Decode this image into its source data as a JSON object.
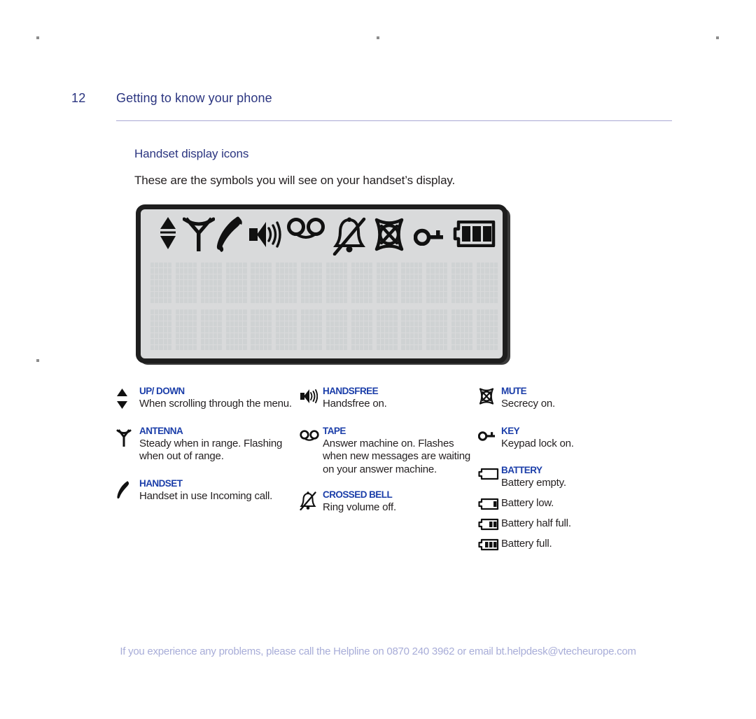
{
  "page": {
    "number": "12",
    "header_title": "Getting to know your phone",
    "section_title": "Handset display icons",
    "section_intro": "These are the symbols you will see on your handset’s display.",
    "footer": "If you experience any problems, please call the Helpline on 0870 240 3962 or email bt.helpdesk@vtecheurope.com"
  },
  "colors": {
    "heading_navy": "#2b3580",
    "term_blue": "#1b3ea9",
    "body_text": "#231f20",
    "rule": "#a9a8d4",
    "footer_text": "#a8add8",
    "lcd_background": "#d9dadb",
    "lcd_border": "#1e1e1e",
    "segment_dot": "#cfd2d3"
  },
  "display": {
    "icons": [
      "up-down-arrows-icon",
      "antenna-icon",
      "handset-icon",
      "handsfree-speaker-icon",
      "tape-icon",
      "crossed-bell-icon",
      "mute-icon",
      "key-icon",
      "battery-full-icon"
    ],
    "segment_rows": 2,
    "segment_columns": 14
  },
  "legend": {
    "column1": [
      {
        "icon": "up-down-arrows-icon",
        "term": "UP/ DOWN",
        "description": "When scrolling through the menu."
      },
      {
        "icon": "antenna-icon",
        "term": "ANTENNA",
        "description": "Steady when in range. Flashing when out of range."
      },
      {
        "icon": "handset-icon",
        "term": "HANDSET",
        "description": "Handset in use Incoming call."
      }
    ],
    "column2": [
      {
        "icon": "handsfree-speaker-icon",
        "term": "HANDSFREE",
        "description": "Handsfree on."
      },
      {
        "icon": "tape-icon",
        "term": "TAPE",
        "description": "Answer machine on. Flashes when new messages are waiting on your answer machine."
      },
      {
        "icon": "crossed-bell-icon",
        "term": "CROSSED BELL",
        "description": "Ring volume off."
      }
    ],
    "column3": [
      {
        "icon": "mute-icon",
        "term": "MUTE",
        "description": "Secrecy on."
      },
      {
        "icon": "key-icon",
        "term": "KEY",
        "description": "Keypad lock on."
      },
      {
        "icon": "battery-empty-icon",
        "term": "BATTERY",
        "description": "Battery empty."
      },
      {
        "icon": "battery-low-icon",
        "term": "",
        "description": "Battery low."
      },
      {
        "icon": "battery-half-icon",
        "term": "",
        "description": "Battery half full."
      },
      {
        "icon": "battery-full-icon",
        "term": "",
        "description": "Battery full."
      }
    ]
  }
}
